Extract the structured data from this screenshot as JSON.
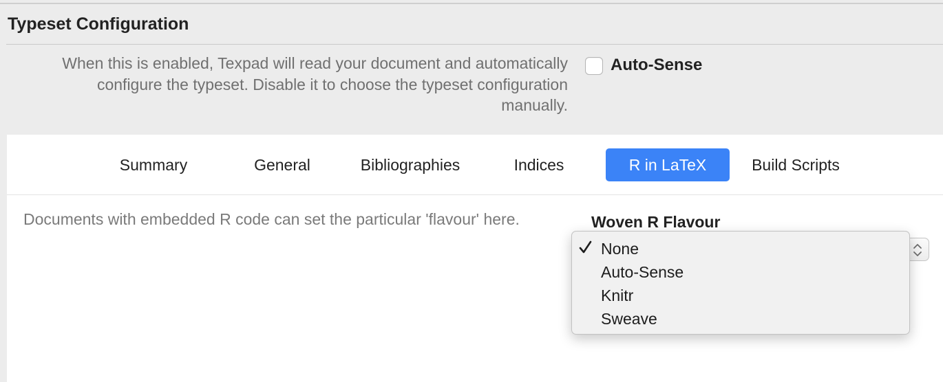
{
  "section": {
    "title": "Typeset Configuration",
    "description_lines": [
      "When this is enabled, Texpad will read your document and automatically",
      "configure the typeset. Disable it to choose the typeset configuration",
      "manually."
    ],
    "auto_sense": {
      "label": "Auto-Sense",
      "checked": false
    }
  },
  "tabs": [
    {
      "label": "Summary",
      "active": false
    },
    {
      "label": "General",
      "active": false
    },
    {
      "label": "Bibliographies",
      "active": false
    },
    {
      "label": "Indices",
      "active": false
    },
    {
      "label": "R in LaTeX",
      "active": true
    },
    {
      "label": "Build Scripts",
      "active": false
    }
  ],
  "r_in_latex": {
    "description": "Documents with embedded R code can set the particular 'flavour' here.",
    "flavour_label": "Woven R Flavour",
    "selected": "None",
    "options": [
      "None",
      "Auto-Sense",
      "Knitr",
      "Sweave"
    ]
  },
  "colors": {
    "accent": "#3b83f7",
    "window_background": "#ececec",
    "panel_background": "#ffffff",
    "secondary_text": "#707070"
  },
  "icons": {
    "checkmark": "checkmark-icon",
    "stepper": "up-down-chevron-icon"
  }
}
